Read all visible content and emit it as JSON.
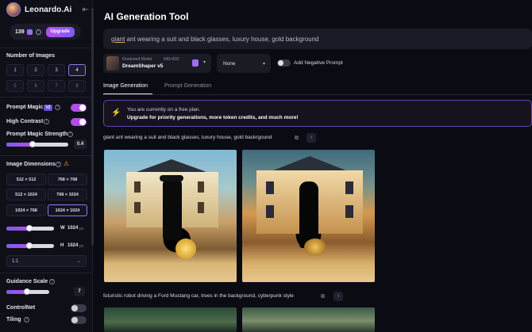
{
  "sidebar": {
    "brand": "Leonardo.Ai",
    "credits": "139",
    "upgrade_label": "Upgrade",
    "num_images_label": "Number of Images",
    "num_images": [
      "1",
      "2",
      "3",
      "4",
      "5",
      "6",
      "7",
      "8"
    ],
    "num_images_selected": "4",
    "prompt_magic_label": "Prompt Magic",
    "prompt_magic_version": "V2",
    "prompt_magic_on": true,
    "high_contrast_label": "High Contrast",
    "high_contrast_on": true,
    "prompt_magic_strength_label": "Prompt Magic Strength",
    "prompt_magic_strength_value": "0.4",
    "image_dimensions_label": "Image Dimensions",
    "dimensions": [
      "512 × 512",
      "768 × 768",
      "512 × 1024",
      "768 × 1024",
      "1024 × 768",
      "1024 × 1024"
    ],
    "dimension_selected": "1024 × 1024",
    "width_label": "W",
    "width_value": "1024",
    "height_label": "H",
    "height_value": "1024",
    "unit": "px",
    "aspect_ratio": "1:1",
    "guidance_scale_label": "Guidance Scale",
    "guidance_scale_value": "7",
    "controlnet_label": "ControlNet",
    "controlnet_on": false,
    "tiling_label": "Tiling",
    "tiling_on": false
  },
  "main": {
    "title": "AI Generation Tool",
    "prompt_first_word": "giant",
    "prompt_rest": " ant wearing a suit and black glasses, luxury house, gold background",
    "model": {
      "kind": "Finetuned Model",
      "resolution": "640×832",
      "name": "DreamShaper v5"
    },
    "style_select": "None",
    "negative_prompt_label": "Add Negative Prompt",
    "tabs": [
      {
        "label": "Image Generation",
        "active": true
      },
      {
        "label": "Prompt Generation",
        "active": false
      }
    ],
    "banner": {
      "line1": "You are currently on a free plan.",
      "line2": "Upgrade for priority generations, more token credits, and much more!"
    },
    "generations": [
      {
        "prompt": "giant ant wearing a suit and black glasses, luxury house, gold backrgound"
      },
      {
        "prompt": "futuristic robot driving a Ford Mustang car, trees in the background, cyberpunk style"
      }
    ]
  },
  "colors": {
    "accent": "#b34ee7",
    "background": "#0b0b13",
    "warning": "#f5a524"
  }
}
